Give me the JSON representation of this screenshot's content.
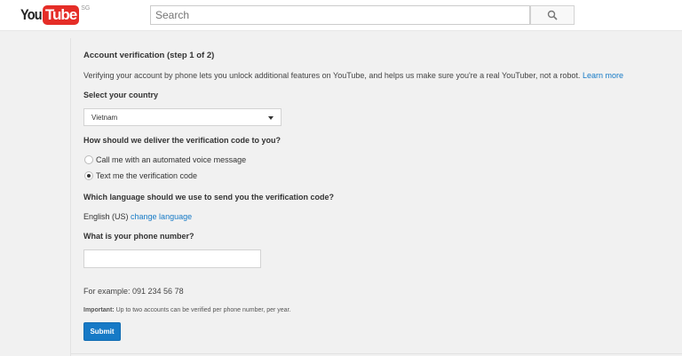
{
  "header": {
    "logo_you": "You",
    "logo_tube": "Tube",
    "logo_region": "SG",
    "search_placeholder": "Search"
  },
  "form": {
    "title": "Account verification (step 1 of 2)",
    "intro": "Verifying your account by phone lets you unlock additional features on YouTube, and helps us make sure you're a real YouTuber, not a robot.",
    "learn_more": "Learn more",
    "country_label": "Select your country",
    "country_value": "Vietnam",
    "delivery_label": "How should we deliver the verification code to you?",
    "delivery_options": [
      {
        "label": "Call me with an automated voice message",
        "selected": false
      },
      {
        "label": "Text me the verification code",
        "selected": true
      }
    ],
    "language_label": "Which language should we use to send you the verification code?",
    "language_value": "English (US)",
    "change_language": "change language",
    "phone_label": "What is your phone number?",
    "phone_value": "",
    "example": "For example: 091 234 56 78",
    "important_label": "Important:",
    "important_text": "Up to two accounts can be verified per phone number, per year.",
    "submit": "Submit"
  }
}
